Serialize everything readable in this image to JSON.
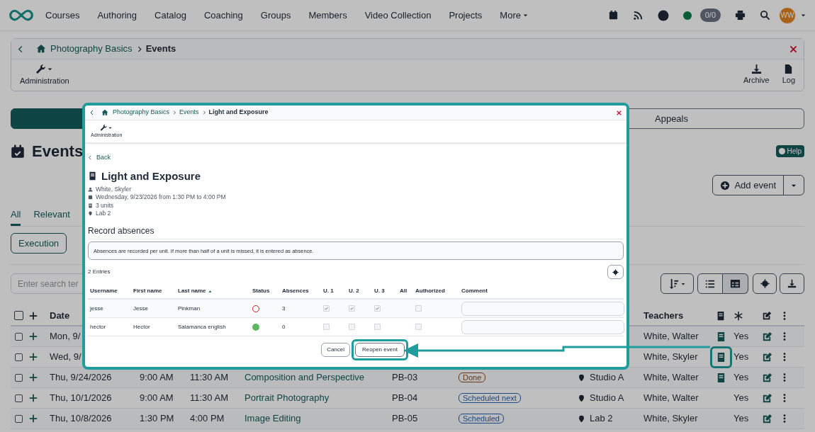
{
  "nav": {
    "items": [
      "Courses",
      "Authoring",
      "Catalog",
      "Coaching",
      "Groups",
      "Members",
      "Video Collection",
      "Projects"
    ],
    "more": "More",
    "online": true,
    "counter": "0/0",
    "avatar": "WW"
  },
  "breadcrumb": {
    "items": [
      "Photography Basics"
    ],
    "current": "Events"
  },
  "toolbar": {
    "left": "Administration",
    "right": [
      {
        "kind": "download",
        "label": "Archive"
      },
      {
        "kind": "file",
        "label": "Log"
      }
    ]
  },
  "segments": [
    {
      "selected": true
    },
    {
      "label": "Appeals",
      "selected": false
    }
  ],
  "heading": "Events",
  "help": "Help",
  "add_button": "Add event",
  "tabs": [
    {
      "label": "All",
      "selected": true
    },
    {
      "label": "Relevant",
      "selected": false
    }
  ],
  "filter_button": "Execution",
  "search": {
    "placeholder": "Enter search ter"
  },
  "table": {
    "all_checked": false,
    "columns": [
      "Date",
      "Teachers"
    ],
    "rows": [
      {
        "checked": false,
        "date": "Mon, 9/",
        "teachers": "White, Walter",
        "lecture": true,
        "visible": "Yes",
        "highlighted": false
      },
      {
        "checked": false,
        "date": "Wed, 9/",
        "teachers": "White, Skyler",
        "lecture": true,
        "visible": "Yes",
        "highlighted": true
      },
      {
        "checked": false,
        "date": "Thu, 9/24/2026",
        "start": "9:00 AM",
        "end": "11:30 AM",
        "title": "Composition and Perspective",
        "code": "PB-03",
        "status": {
          "label": "Done",
          "kind": "done"
        },
        "location": "Studio A",
        "teachers": "White, Walter",
        "lecture": true,
        "visible": "Yes",
        "highlighted": false
      },
      {
        "checked": false,
        "date": "Thu, 10/1/2026",
        "start": "9:00 AM",
        "end": "11:30 AM",
        "title": "Portrait Photography",
        "code": "PB-04",
        "status": {
          "label": "Scheduled next",
          "kind": "scheduled"
        },
        "location": "Studio A",
        "teachers": "White, Walter",
        "lecture": false,
        "visible": "Yes"
      },
      {
        "checked": false,
        "date": "Thu, 10/8/2026",
        "start": "1:30 PM",
        "end": "4:00 PM",
        "title": "Image Editing",
        "code": "PB-05",
        "status": {
          "label": "Scheduled",
          "kind": "scheduled"
        },
        "location": "Lab 2",
        "teachers": "White, Skyler",
        "lecture": false,
        "visible": "Yes"
      }
    ]
  },
  "modal": {
    "breadcrumb": [
      "Photography Basics",
      "Events"
    ],
    "current": "Light and Exposure",
    "admin": "Administration",
    "back": "Back",
    "title": "Light and Exposure",
    "meta": [
      {
        "kind": "person",
        "text": "White, Skyler"
      },
      {
        "kind": "date",
        "text": "Wednesday, 9/23/2026 from 1:30 PM to 4:00 PM"
      },
      {
        "kind": "units",
        "text": "3 units"
      },
      {
        "kind": "location",
        "text": "Lab 2"
      }
    ],
    "section": "Record absences",
    "info": "Absences are recorded per unit. If more than half of a unit is missed, it is entered as absence.",
    "entries": "2 Entries",
    "columns": [
      {
        "label": "Username"
      },
      {
        "label": "First name"
      },
      {
        "label": "Last name",
        "sorted": true
      },
      {
        "label": "Status"
      },
      {
        "label": "Absences"
      },
      {
        "label": "U. 1"
      },
      {
        "label": "U. 2"
      },
      {
        "label": "U. 3"
      },
      {
        "label": "All"
      },
      {
        "label": "Authorized"
      },
      {
        "label": "Comment"
      }
    ],
    "rows": [
      {
        "username": "jesse",
        "first": "Jesse",
        "last": "Pinkman",
        "present": false,
        "absences": "3",
        "units": [
          {
            "checked": true,
            "disabled": true
          },
          {
            "checked": true,
            "disabled": true
          },
          {
            "checked": true,
            "disabled": true
          }
        ],
        "authorized": {
          "checked": false,
          "disabled": true
        }
      },
      {
        "username": "hector",
        "first": "Hector",
        "last": "Salamanca english",
        "present": true,
        "absences": "0",
        "units": [
          {
            "checked": false,
            "disabled": true
          },
          {
            "checked": false,
            "disabled": true
          },
          {
            "checked": false,
            "disabled": true
          }
        ],
        "authorized": {
          "checked": false,
          "disabled": true
        }
      }
    ],
    "cancel": "Cancel",
    "primary": "Reopen event"
  }
}
